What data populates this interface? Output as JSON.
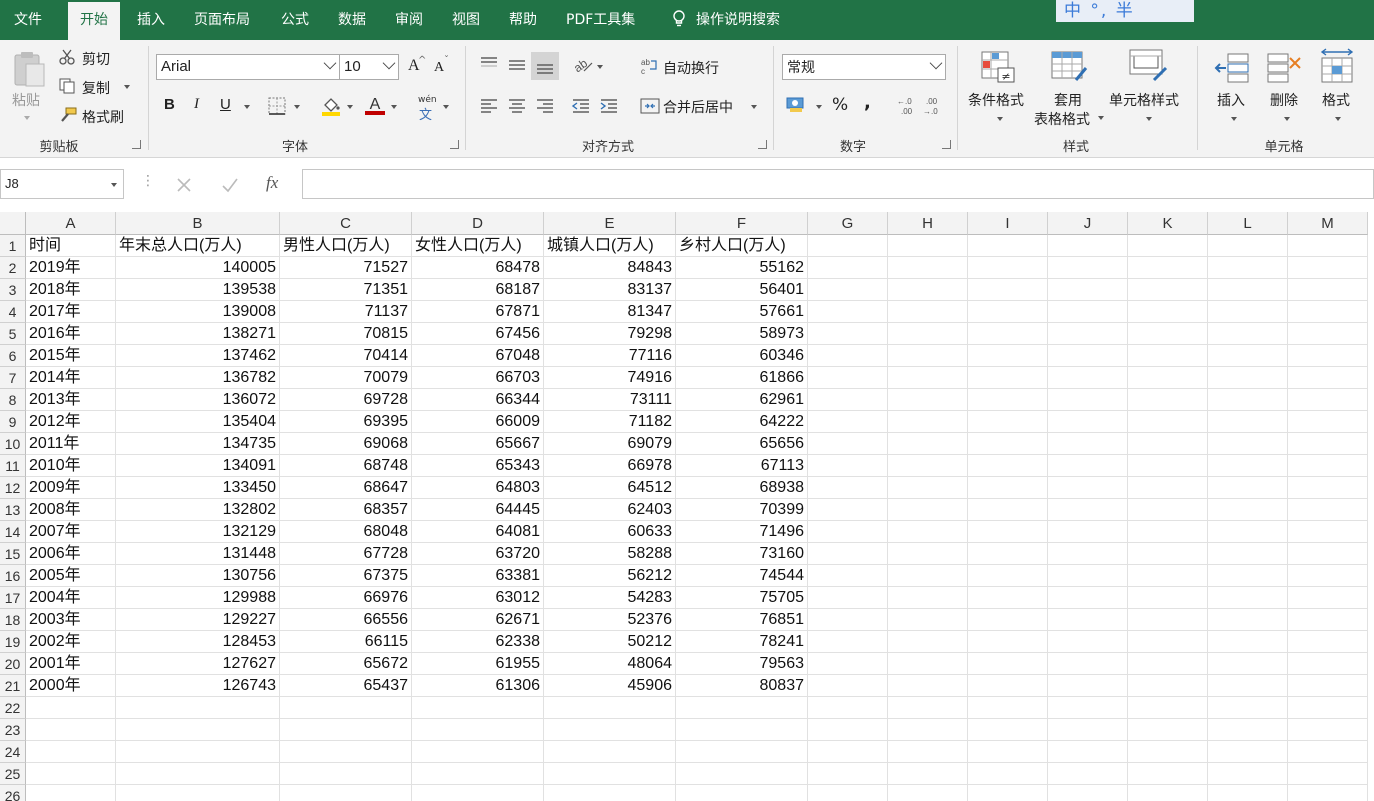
{
  "tabs": [
    "文件",
    "开始",
    "插入",
    "页面布局",
    "公式",
    "数据",
    "审阅",
    "视图",
    "帮助",
    "PDF工具集"
  ],
  "tell_me": "操作说明搜索",
  "ime_indicator": "中 °, 半",
  "ribbon": {
    "clipboard": {
      "paste": "粘贴",
      "cut": "剪切",
      "copy": "复制",
      "format_painter": "格式刷",
      "label": "剪贴板"
    },
    "font": {
      "name": "Arial",
      "size": "10",
      "bold": "B",
      "italic": "I",
      "underline": "U",
      "grow": "A",
      "shrink": "A",
      "color_letter": "A",
      "phonetic": "wén",
      "phonetic_char": "文",
      "label": "字体"
    },
    "alignment": {
      "wrap": "自动换行",
      "merge": "合并后居中",
      "label": "对齐方式"
    },
    "number": {
      "format": "常规",
      "percent": "%",
      "comma": ",",
      "label": "数字"
    },
    "styles": {
      "conditional": "条件格式",
      "table_line1": "套用",
      "table_line2": "表格格式",
      "cell_styles": "单元格样式",
      "label": "样式"
    },
    "cells": {
      "insert": "插入",
      "delete": "删除",
      "format": "格式",
      "label": "单元格"
    }
  },
  "formula_bar": {
    "name_box": "J8",
    "fx": "fx",
    "content": ""
  },
  "columns": [
    "A",
    "B",
    "C",
    "D",
    "E",
    "F",
    "G",
    "H",
    "I",
    "J",
    "K",
    "L",
    "M"
  ],
  "rows": [
    "1",
    "2",
    "3",
    "4",
    "5",
    "6",
    "7",
    "8",
    "9",
    "10",
    "11",
    "12",
    "13",
    "14",
    "15",
    "16",
    "17",
    "18",
    "19",
    "20",
    "21",
    "22",
    "23",
    "24",
    "25",
    "26"
  ],
  "header_row": [
    "时间",
    "年末总人口(万人)",
    "男性人口(万人)",
    "女性人口(万人)",
    "城镇人口(万人)",
    "乡村人口(万人)"
  ],
  "data_rows": [
    [
      "2019年",
      "140005",
      "71527",
      "68478",
      "84843",
      "55162"
    ],
    [
      "2018年",
      "139538",
      "71351",
      "68187",
      "83137",
      "56401"
    ],
    [
      "2017年",
      "139008",
      "71137",
      "67871",
      "81347",
      "57661"
    ],
    [
      "2016年",
      "138271",
      "70815",
      "67456",
      "79298",
      "58973"
    ],
    [
      "2015年",
      "137462",
      "70414",
      "67048",
      "77116",
      "60346"
    ],
    [
      "2014年",
      "136782",
      "70079",
      "66703",
      "74916",
      "61866"
    ],
    [
      "2013年",
      "136072",
      "69728",
      "66344",
      "73111",
      "62961"
    ],
    [
      "2012年",
      "135404",
      "69395",
      "66009",
      "71182",
      "64222"
    ],
    [
      "2011年",
      "134735",
      "69068",
      "65667",
      "69079",
      "65656"
    ],
    [
      "2010年",
      "134091",
      "68748",
      "65343",
      "66978",
      "67113"
    ],
    [
      "2009年",
      "133450",
      "68647",
      "64803",
      "64512",
      "68938"
    ],
    [
      "2008年",
      "132802",
      "68357",
      "64445",
      "62403",
      "70399"
    ],
    [
      "2007年",
      "132129",
      "68048",
      "64081",
      "60633",
      "71496"
    ],
    [
      "2006年",
      "131448",
      "67728",
      "63720",
      "58288",
      "73160"
    ],
    [
      "2005年",
      "130756",
      "67375",
      "63381",
      "56212",
      "74544"
    ],
    [
      "2004年",
      "129988",
      "66976",
      "63012",
      "54283",
      "75705"
    ],
    [
      "2003年",
      "129227",
      "66556",
      "62671",
      "52376",
      "76851"
    ],
    [
      "2002年",
      "128453",
      "66115",
      "62338",
      "50212",
      "78241"
    ],
    [
      "2001年",
      "127627",
      "65672",
      "61955",
      "48064",
      "79563"
    ],
    [
      "2000年",
      "126743",
      "65437",
      "61306",
      "45906",
      "80837"
    ]
  ],
  "colors": {
    "excel_green": "#217346",
    "ribbon_bg": "#f3f3f3",
    "font_color": "#c00000",
    "highlight": "#ffd700"
  }
}
